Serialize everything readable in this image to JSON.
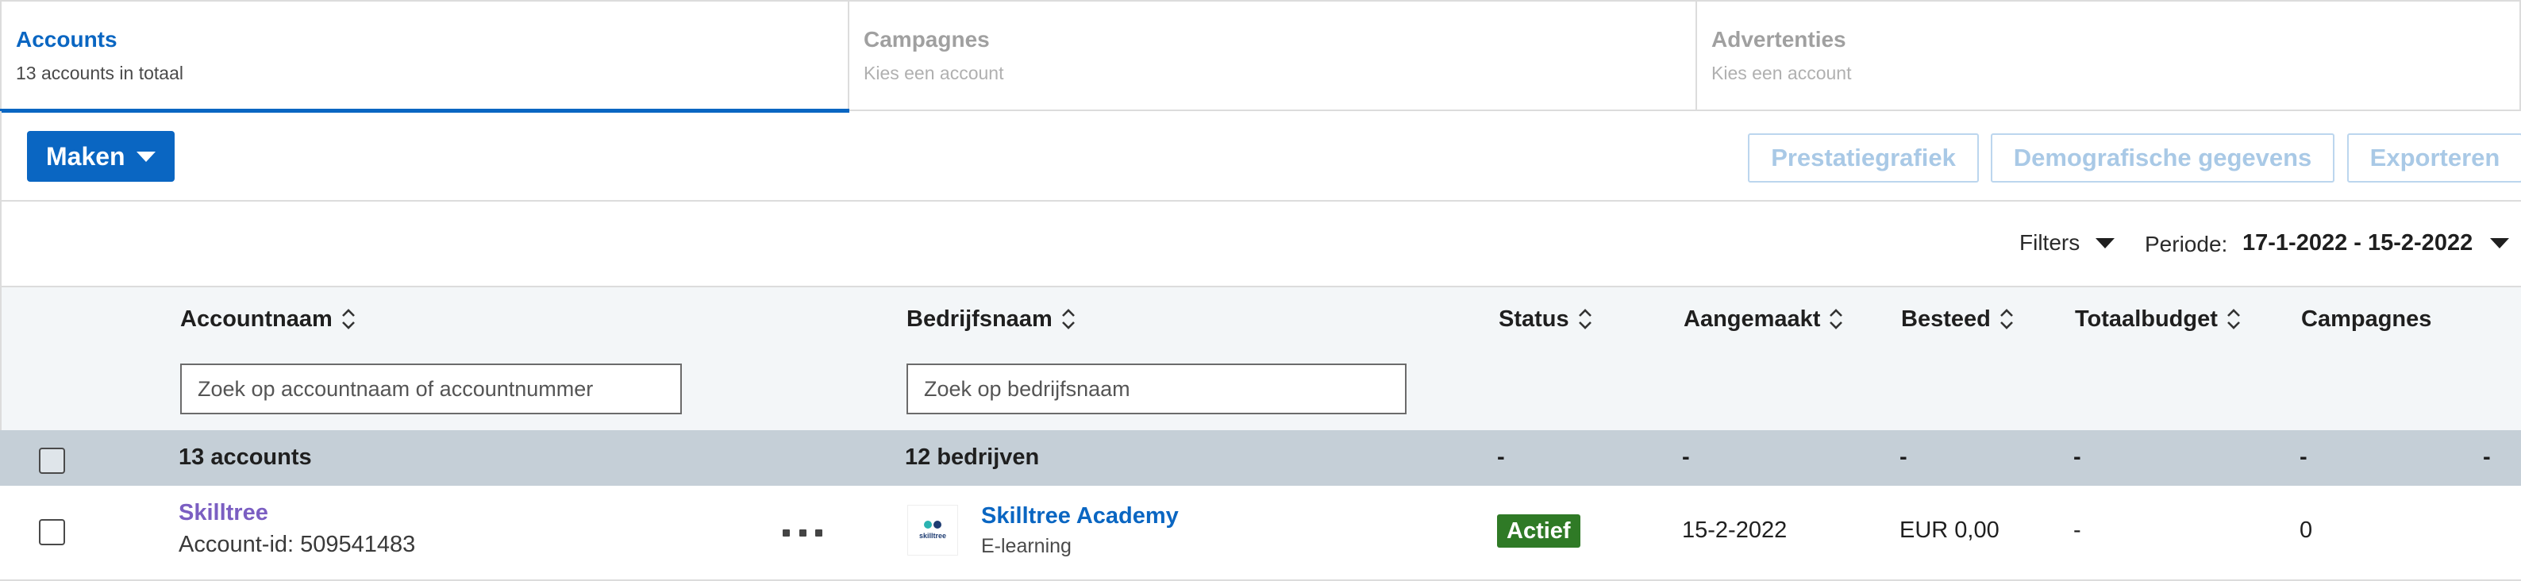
{
  "tabs": [
    {
      "title": "Accounts",
      "subtitle": "13 accounts in totaal",
      "active": true
    },
    {
      "title": "Campagnes",
      "subtitle": "Kies een account",
      "active": false
    },
    {
      "title": "Advertenties",
      "subtitle": "Kies een account",
      "active": false
    }
  ],
  "toolbar": {
    "make_label": "Maken",
    "performance_chart_label": "Prestatiegrafiek",
    "demographics_label": "Demografische gegevens",
    "export_label": "Exporteren"
  },
  "filter_bar": {
    "filters_label": "Filters",
    "period_label": "Periode:",
    "period_value": "17-1-2022 - 15-2-2022"
  },
  "table": {
    "columns": {
      "account_name": "Accountnaam",
      "company_name": "Bedrijfsnaam",
      "status": "Status",
      "created": "Aangemaakt",
      "spent": "Besteed",
      "total_budget": "Totaalbudget",
      "campaigns": "Campagnes"
    },
    "search": {
      "account_placeholder": "Zoek op accountnaam of accountnummer",
      "company_placeholder": "Zoek op bedrijfsnaam"
    },
    "summary": {
      "accounts": "13 accounts",
      "companies": "12 bedrijven",
      "status": "-",
      "created": "-",
      "spent": "-",
      "total_budget": "-",
      "campaigns": "-",
      "extra": "-"
    },
    "rows": [
      {
        "account_name": "Skilltree",
        "account_id": "Account-id: 509541483",
        "company_name": "Skilltree Academy",
        "industry": "E-learning",
        "logo_text": "skilltree",
        "status": "Actief",
        "created": "15-2-2022",
        "spent": "EUR 0,00",
        "total_budget": "-",
        "campaigns": "0"
      }
    ]
  },
  "colors": {
    "accent": "#0a66c2",
    "status_active": "#2f7a26",
    "account_link": "#7b5ec2"
  }
}
